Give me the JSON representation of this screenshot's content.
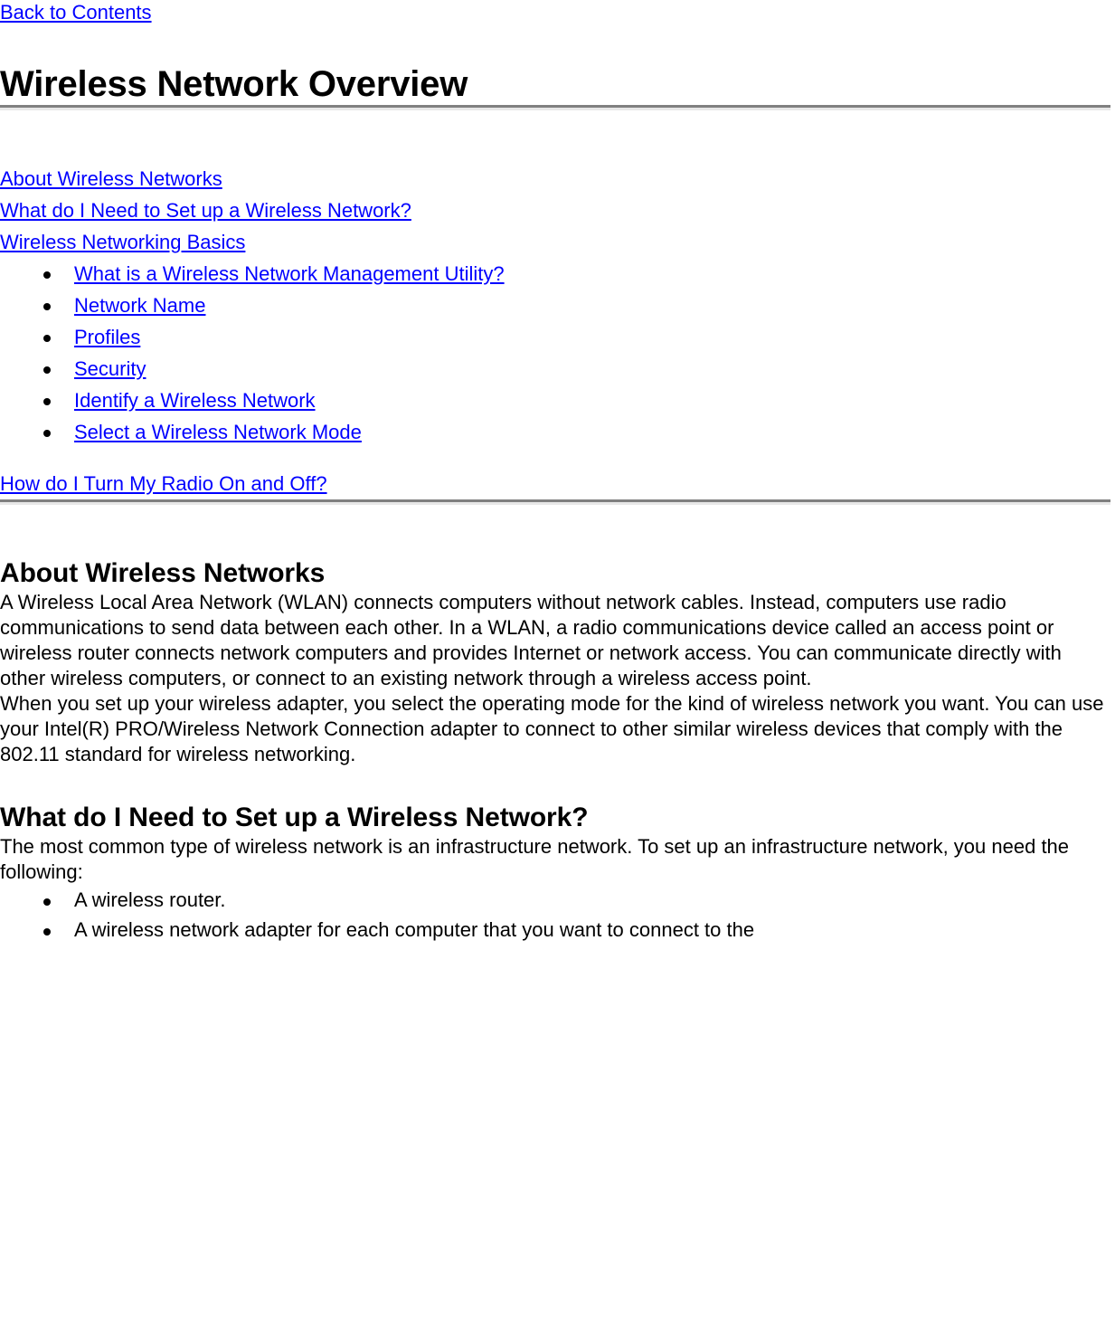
{
  "nav": {
    "back_link": "Back to Contents"
  },
  "header": {
    "title": "Wireless Network Overview"
  },
  "toc": {
    "links": [
      "About Wireless Networks",
      "What do I Need to Set up a Wireless Network?",
      "Wireless Networking Basics"
    ],
    "sub_links": [
      "What is a Wireless Network Management Utility?",
      "Network Name",
      "Profiles",
      "Security",
      "Identify a Wireless Network",
      "Select a Wireless Network Mode"
    ],
    "final_link": "How do I Turn My Radio On and Off?"
  },
  "sections": [
    {
      "heading": "About Wireless Networks",
      "paragraphs": [
        "A Wireless Local Area Network (WLAN) connects computers without network cables. Instead, computers use radio communications to send data between each other. In a WLAN, a radio communications device called an access point or wireless router connects network computers and provides Internet or network access. You can communicate directly with other wireless computers, or connect to an existing network through a wireless access point.",
        "When you set up your wireless adapter, you select the operating mode for the kind of wireless network you want. You can use your Intel(R) PRO/Wireless Network Connection adapter to connect to other similar wireless devices that comply with the 802.11 standard for wireless networking."
      ]
    },
    {
      "heading": "What do I Need to Set up a Wireless Network?",
      "paragraphs": [
        "The most common type of wireless network is an infrastructure network. To set up an infrastructure network, you need the following:"
      ],
      "items": [
        "A wireless router.",
        "A wireless network adapter for each computer that you want to connect to the"
      ]
    }
  ],
  "colors": {
    "link": "#0000FF",
    "text": "#000000",
    "rule_top": "#808080",
    "rule_bottom": "#E8E8E8",
    "background": "#FFFFFF"
  }
}
